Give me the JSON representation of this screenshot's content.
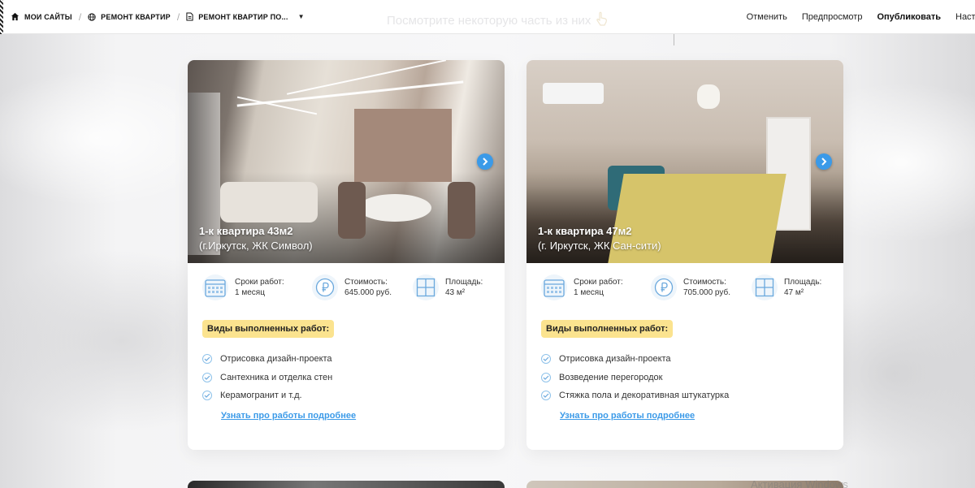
{
  "toolbar": {
    "breadcrumbs": [
      {
        "label": "Мои сайты",
        "icon": "home-icon"
      },
      {
        "label": "Ремонт квартир",
        "icon": "globe-icon"
      },
      {
        "label": "Ремонт квартир по...",
        "icon": "page-icon"
      }
    ],
    "cancel_label": "Отменить",
    "preview_label": "Предпросмотр",
    "publish_label": "Опубликовать",
    "settings_label": "Настр"
  },
  "section": {
    "ghost_heading": "Посмотрите некоторую часть из них"
  },
  "cards": [
    {
      "title": "1-к квартира 43м2",
      "subtitle": "(г.Иркутск, ЖК Символ)",
      "stats": [
        {
          "label": "Сроки работ:",
          "value": "1 месяц",
          "icon": "calendar-icon"
        },
        {
          "label": "Стоимость:",
          "value": "645.000 руб.",
          "icon": "ruble-icon"
        },
        {
          "label": "Площадь:",
          "value": "43 м²",
          "icon": "area-icon"
        }
      ],
      "works_badge": "Виды выполненных работ:",
      "works": [
        "Отрисовка дизайн-проекта",
        "Сантехника и отделка стен",
        "Керамогранит и т.д."
      ],
      "more_link": "Узнать про работы подробнее"
    },
    {
      "title": "1-к квартира 47м2",
      "subtitle": "(г. Иркутск, ЖК Сан-сити)",
      "stats": [
        {
          "label": "Сроки работ:",
          "value": "1 месяц",
          "icon": "calendar-icon"
        },
        {
          "label": "Стоимость:",
          "value": "705.000 руб.",
          "icon": "ruble-icon"
        },
        {
          "label": "Площадь:",
          "value": "47 м²",
          "icon": "area-icon"
        }
      ],
      "works_badge": "Виды выполненных работ:",
      "works": [
        "Отрисовка дизайн-проекта",
        "Возведение перегородок",
        "Стяжка пола и декоративная штукатурка"
      ],
      "more_link": "Узнать про работы подробнее"
    }
  ],
  "watermark": "Активация Windows",
  "colors": {
    "accent": "#3b9ae8",
    "badge": "#fbe38f",
    "icon_bg": "#eef5fb"
  }
}
